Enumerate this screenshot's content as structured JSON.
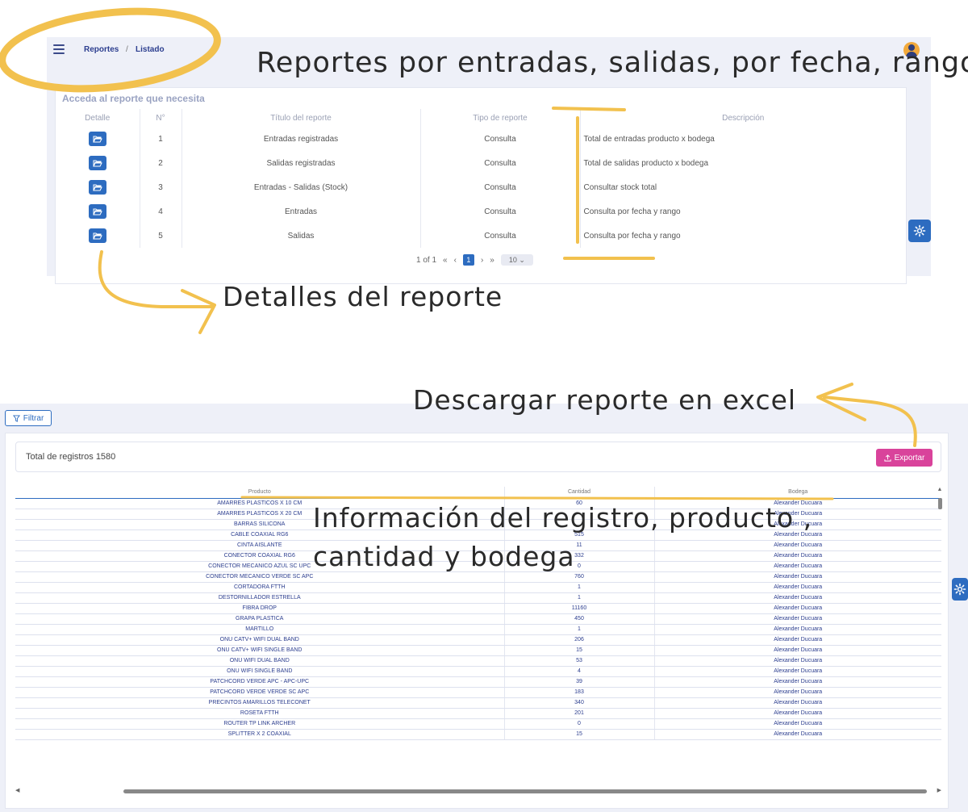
{
  "top": {
    "breadcrumb": [
      "Reportes",
      "/",
      "Listado"
    ],
    "card_title": "Acceda al reporte que necesita",
    "columns": [
      "Detalle",
      "N°",
      "Título del reporte",
      "Tipo de reporte",
      "Descripción"
    ],
    "rows": [
      {
        "n": "1",
        "title": "Entradas registradas",
        "type": "Consulta",
        "desc": "Total de entradas producto x bodega"
      },
      {
        "n": "2",
        "title": "Salidas registradas",
        "type": "Consulta",
        "desc": "Total de salidas producto x bodega"
      },
      {
        "n": "3",
        "title": "Entradas - Salidas (Stock)",
        "type": "Consulta",
        "desc": "Consultar stock total"
      },
      {
        "n": "4",
        "title": "Entradas",
        "type": "Consulta",
        "desc": "Consulta por fecha y rango"
      },
      {
        "n": "5",
        "title": "Salidas",
        "type": "Consulta",
        "desc": "Consulta por fecha y rango"
      }
    ],
    "pager": {
      "info": "1 of 1",
      "first": "«",
      "prev": "‹",
      "current": "1",
      "next": "›",
      "last": "»",
      "page_size": "10"
    }
  },
  "bottom": {
    "filter_label": "Filtrar",
    "total_label": "Total de registros  1580",
    "export_label": "Exportar",
    "columns": [
      "Producto",
      "Cantidad",
      "Bodega"
    ],
    "rows": [
      [
        "AMARRES PLASTICOS X 10 CM",
        "60",
        "Alexander Ducuara"
      ],
      [
        "AMARRES PLASTICOS X 20 CM",
        "",
        "Alexander Ducuara"
      ],
      [
        "BARRAS SILICONA",
        "",
        "Alexander Ducuara"
      ],
      [
        "CABLE COAXIAL RG6",
        "515",
        "Alexander Ducuara"
      ],
      [
        "CINTA AISLANTE",
        "11",
        "Alexander Ducuara"
      ],
      [
        "CONECTOR COAXIAL RG6",
        "332",
        "Alexander Ducuara"
      ],
      [
        "CONECTOR MECANICO AZUL SC UPC",
        "0",
        "Alexander Ducuara"
      ],
      [
        "CONECTOR MECANICO VERDE SC APC",
        "760",
        "Alexander Ducuara"
      ],
      [
        "CORTADORA FTTH",
        "1",
        "Alexander Ducuara"
      ],
      [
        "DESTORNILLADOR ESTRELLA",
        "1",
        "Alexander Ducuara"
      ],
      [
        "FIBRA DROP",
        "11160",
        "Alexander Ducuara"
      ],
      [
        "GRAPA PLASTICA",
        "450",
        "Alexander Ducuara"
      ],
      [
        "MARTILLO",
        "1",
        "Alexander Ducuara"
      ],
      [
        "ONU CATV+ WIFI DUAL BAND",
        "206",
        "Alexander Ducuara"
      ],
      [
        "ONU CATV+ WIFI SINGLE BAND",
        "15",
        "Alexander Ducuara"
      ],
      [
        "ONU WIFI DUAL BAND",
        "53",
        "Alexander Ducuara"
      ],
      [
        "ONU WIFI SINGLE BAND",
        "4",
        "Alexander Ducuara"
      ],
      [
        "PATCHCORD VERDE APC - APC-UPC",
        "39",
        "Alexander Ducuara"
      ],
      [
        "PATCHCORD VERDE VERDE SC APC",
        "183",
        "Alexander Ducuara"
      ],
      [
        "PRECINTOS AMARILLOS TELECONET",
        "340",
        "Alexander Ducuara"
      ],
      [
        "ROSETA FTTH",
        "201",
        "Alexander Ducuara"
      ],
      [
        "ROUTER TP LINK ARCHER",
        "0",
        "Alexander Ducuara"
      ],
      [
        "SPLITTER X 2 COAXIAL",
        "15",
        "Alexander Ducuara"
      ]
    ]
  },
  "annotations": {
    "reportes": "Reportes  por entradas, salidas, por fecha, rango",
    "detalles": "Detalles del reporte",
    "descargar": "Descargar reporte en excel",
    "info_line1": "Información del registro, producto ,",
    "info_line2": "cantidad y bodega"
  },
  "colors": {
    "primary": "#2d6cc0",
    "export": "#d9439b",
    "marker": "#f2c14e",
    "panel": "#eef0f8"
  },
  "icons": [
    "menu-icon",
    "user-avatar-icon",
    "folder-open-icon",
    "gear-icon",
    "filter-icon",
    "upload-icon"
  ]
}
